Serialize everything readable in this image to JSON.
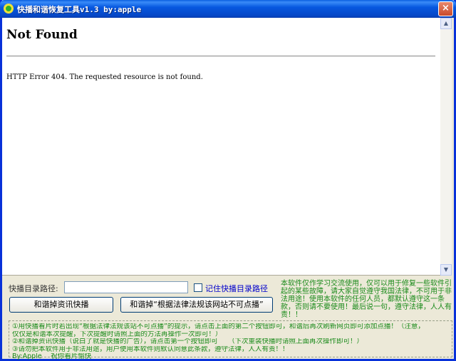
{
  "window": {
    "title": "快播和谐恢复工具v1.3 by:apple",
    "close_label": "×"
  },
  "webview": {
    "heading": "Not Found",
    "body_text": "HTTP Error 404. The requested resource is not found."
  },
  "controls": {
    "path_label": "快播目录路径:",
    "path_value": "",
    "remember_label": "记住快播目录路径",
    "remember_checked": false,
    "btn_reset": "和谐掉资讯快播",
    "btn_fix": "和谐掉“根据法律法规该网站不可点播”"
  },
  "notice_right": "本软件仅作学习交流使用，仅可以用于修复一些软件引起的某些故障，请大家自觉遵守我国法律，不可用于非法用途！使用本软件的任何人员，都默认遵守这一条款，否则请不要使用！最后说一句，遵守法律，人人有责！！",
  "notice_box": {
    "line1": "①用快播看片时若出现“根据法律法规该站不可点播”的提示，请点击上面的第二个按钮即可，和谐后再次刷新网页即可添加点播！（注意，",
    "line2": "仅仅是和谐本次提醒，下次提醒时请照上面的方法再操作一次即可！）",
    "line3": "②和谐掉资讯快播（说白了就是快播的广告），请点击第一个按钮即可　　（下次重装快播时请照上面再次操作即可！）",
    "line4": "③请勿把本软件用于非法用途，用户使用本软件则默认同意此条款，遵守法律，人人有责！！",
    "line5": "By:Apple　 祝你看片愉快"
  }
}
